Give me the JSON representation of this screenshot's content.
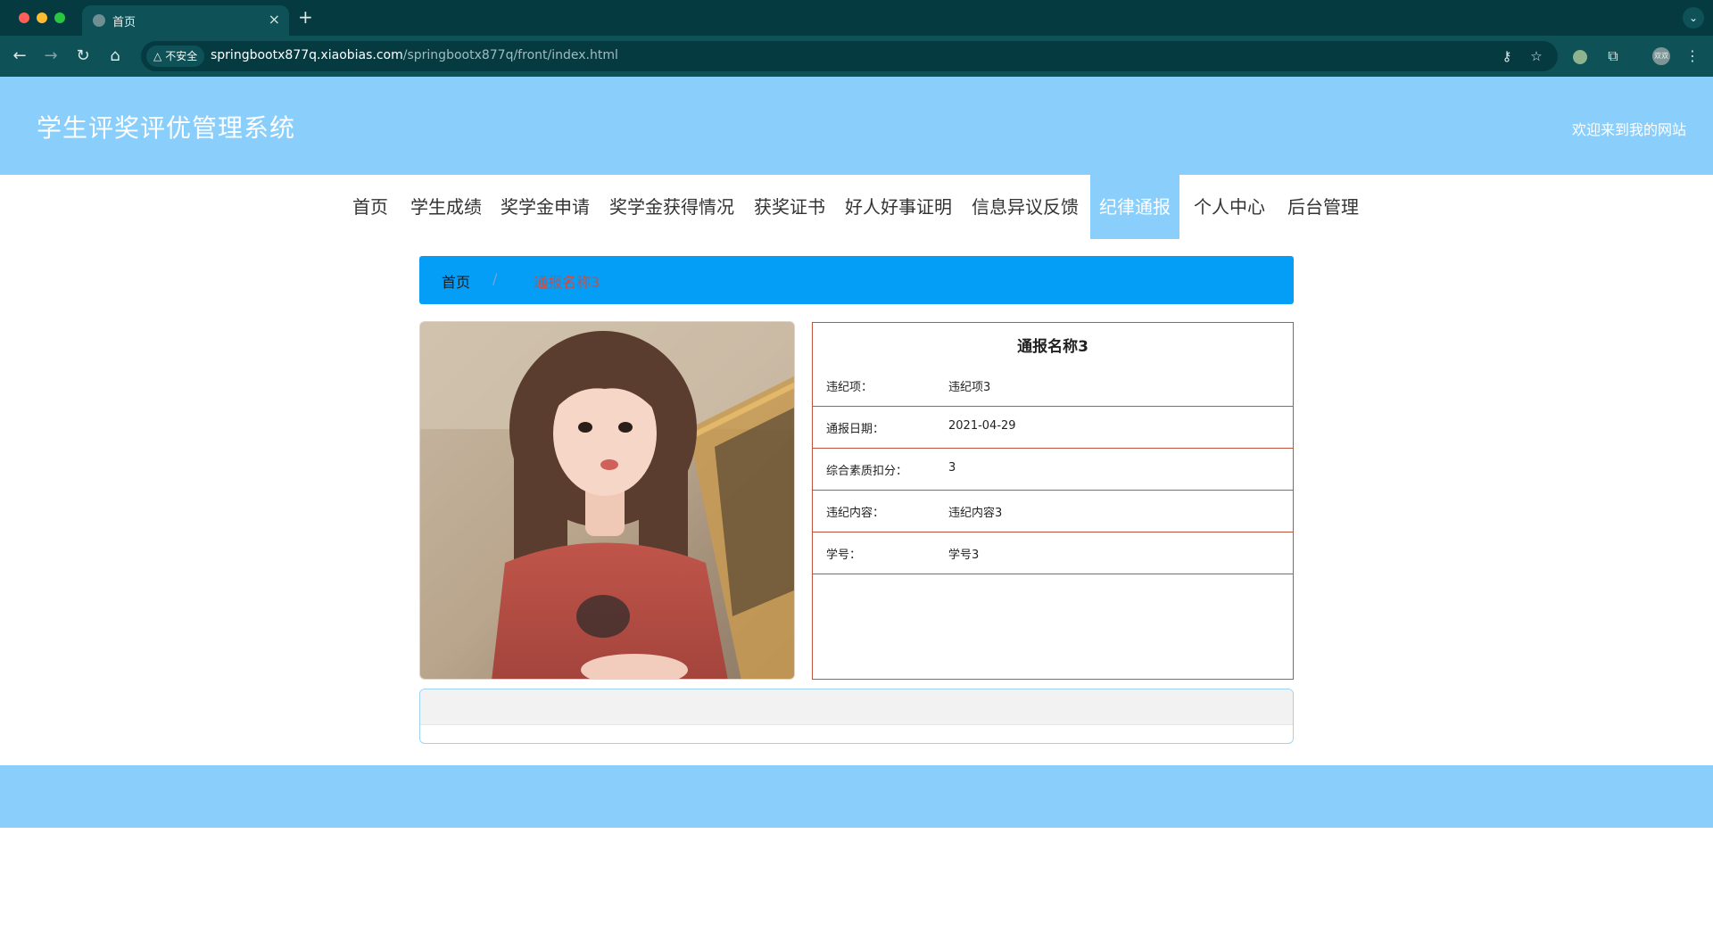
{
  "browser": {
    "tab_title": "首页",
    "tab_close": "×",
    "new_tab": "+",
    "security_label": "不安全",
    "url_host": "springbootx877q.xiaobias.com",
    "url_path": "/springbootx877q/front/index.html",
    "profile_label": "双双"
  },
  "header": {
    "site_title": "学生评奖评优管理系统",
    "welcome": "欢迎来到我的网站"
  },
  "nav": {
    "items": [
      "首页",
      "学生成绩",
      "奖学金申请",
      "奖学金获得情况",
      "获奖证书",
      "好人好事证明",
      "信息异议反馈",
      "纪律通报",
      "个人中心",
      "后台管理"
    ],
    "active": "纪律通报"
  },
  "breadcrumb": {
    "home": "首页",
    "separator": "/",
    "current": "通报名称3"
  },
  "detail": {
    "title": "通报名称3",
    "rows": [
      {
        "label": "违纪项：",
        "value": "违纪项3"
      },
      {
        "label": "通报日期：",
        "value": "2021-04-29"
      },
      {
        "label": "综合素质扣分：",
        "value": "3"
      },
      {
        "label": "违纪内容：",
        "value": "违纪内容3"
      },
      {
        "label": "学号：",
        "value": "学号3"
      }
    ]
  },
  "colors": {
    "header_bg": "#8acffb",
    "breadcrumb_bg": "#049ef7",
    "breadcrumb_current": "#d14b3e",
    "detail_border": "#c0533c",
    "browser_dark": "#063a41",
    "browser_toolbar": "#0e5157"
  }
}
